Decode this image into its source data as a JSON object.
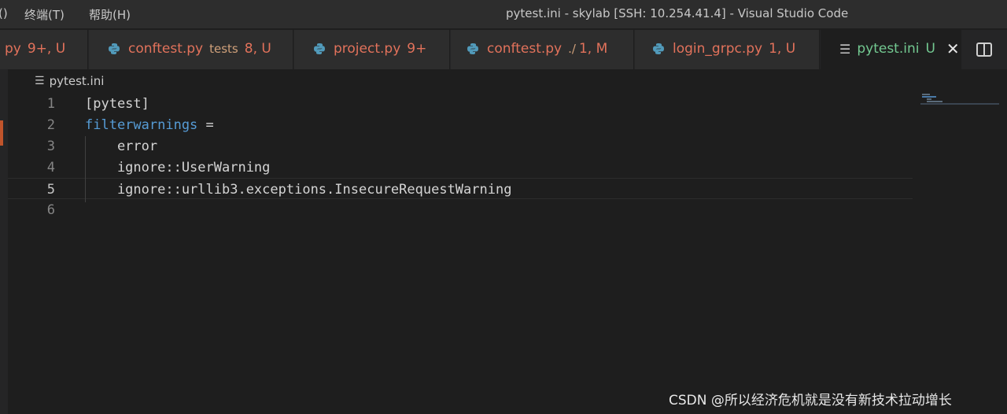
{
  "titlebar": {
    "menu_fragment": "()",
    "menu_terminal": "终端(T)",
    "menu_help": "帮助(H)",
    "window_title": "pytest.ini - skylab [SSH: 10.254.41.4] - Visual Studio Code"
  },
  "tabs": [
    {
      "name": "py",
      "desc": "",
      "status": "9+, U",
      "icon": "python-icon"
    },
    {
      "name": "conftest.py",
      "desc": "tests",
      "status": "8, U",
      "icon": "python-icon"
    },
    {
      "name": "project.py",
      "desc": "",
      "status": "9+",
      "icon": "python-icon"
    },
    {
      "name": "conftest.py",
      "desc": "./",
      "status": "1, M",
      "icon": "python-icon"
    },
    {
      "name": "login_grpc.py",
      "desc": "",
      "status": "1, U",
      "icon": "python-icon"
    },
    {
      "name": "pytest.ini",
      "desc": "",
      "status": "U",
      "icon": "ini-file-icon",
      "active": true
    }
  ],
  "breadcrumb": {
    "file": "pytest.ini"
  },
  "editor": {
    "lines": [
      {
        "num": "1",
        "key": "",
        "text": "[pytest]"
      },
      {
        "num": "2",
        "key": "filterwarnings",
        "text": " ="
      },
      {
        "num": "3",
        "key": "",
        "text": "    error"
      },
      {
        "num": "4",
        "key": "",
        "text": "    ignore::UserWarning"
      },
      {
        "num": "5",
        "key": "",
        "text": "    ignore::urllib3.exceptions.InsecureRequestWarning"
      },
      {
        "num": "6",
        "key": "",
        "text": ""
      }
    ],
    "current_line": "5"
  },
  "watermark": "CSDN @所以经济危机就是没有新技术拉动增长",
  "colors": {
    "background": "#1e1e1e",
    "untracked_tab": "#e2725b",
    "active_tab": "#73c991",
    "keyword": "#569cd6"
  }
}
